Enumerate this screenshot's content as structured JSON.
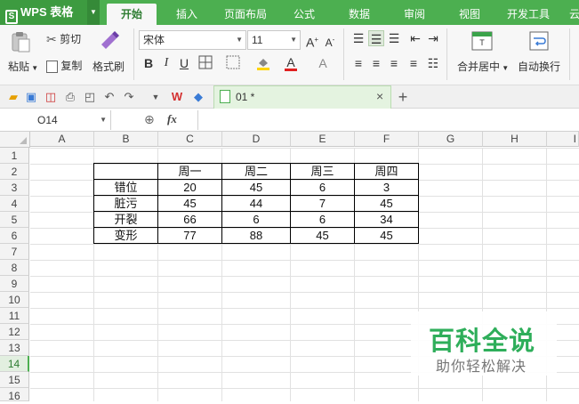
{
  "app": {
    "name": "WPS 表格"
  },
  "tabs": [
    "开始",
    "插入",
    "页面布局",
    "公式",
    "数据",
    "审阅",
    "视图",
    "开发工具",
    "云"
  ],
  "active_tab": "开始",
  "ribbon": {
    "paste": "粘贴",
    "cut": "剪切",
    "copy": "复制",
    "format_painter": "格式刷",
    "font_name": "宋体",
    "font_size": "11",
    "bold": "B",
    "italic": "I",
    "underline": "U",
    "merge_center": "合并居中",
    "wrap_text": "自动换行"
  },
  "document_tab": {
    "label": "01 *"
  },
  "formula_bar": {
    "cell_ref": "O14",
    "fx": "fx",
    "content": ""
  },
  "columns": [
    "A",
    "B",
    "C",
    "D",
    "E",
    "F",
    "G",
    "H",
    "I"
  ],
  "rows": [
    "1",
    "2",
    "3",
    "4",
    "5",
    "6",
    "7",
    "8",
    "9",
    "10",
    "11",
    "12",
    "13",
    "14",
    "15",
    "16"
  ],
  "selected_row": "14",
  "table": {
    "header": [
      "",
      "周一",
      "周二",
      "周三",
      "周四"
    ],
    "rows": [
      [
        "错位",
        "20",
        "45",
        "6",
        "3"
      ],
      [
        "脏污",
        "45",
        "44",
        "7",
        "45"
      ],
      [
        "开裂",
        "66",
        "6",
        "6",
        "34"
      ],
      [
        "变形",
        "77",
        "88",
        "45",
        "45"
      ]
    ]
  },
  "watermark": {
    "title": "百科全说",
    "subtitle": "助你轻松解决"
  }
}
